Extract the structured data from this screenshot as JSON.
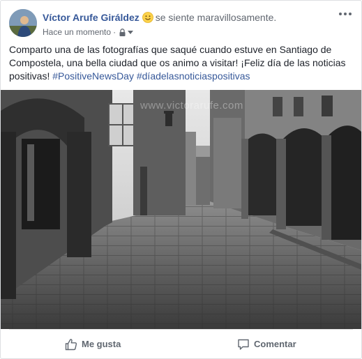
{
  "post": {
    "author": "Víctor Arufe Giráldez",
    "feeling": "se siente maravillosamente.",
    "timestamp": "Hace un momento",
    "separator": "·",
    "privacy_icon": "lock-icon",
    "text_part1": "Comparto una de las fotografías que saqué cuando estuve en Santiago de Compostela, una bella ciudad que os animo a visitar! ¡Feliz día de las noticias positivas! ",
    "hashtag1": "#PositiveNewsDay",
    "hashtag2": "#díadelasnoticiaspositivas",
    "watermark": "www.victorarufe.com"
  },
  "actions": {
    "like_label": "Me gusta",
    "comment_label": "Comentar"
  },
  "colors": {
    "link": "#365899",
    "text": "#1d2129",
    "secondary": "#616770"
  }
}
